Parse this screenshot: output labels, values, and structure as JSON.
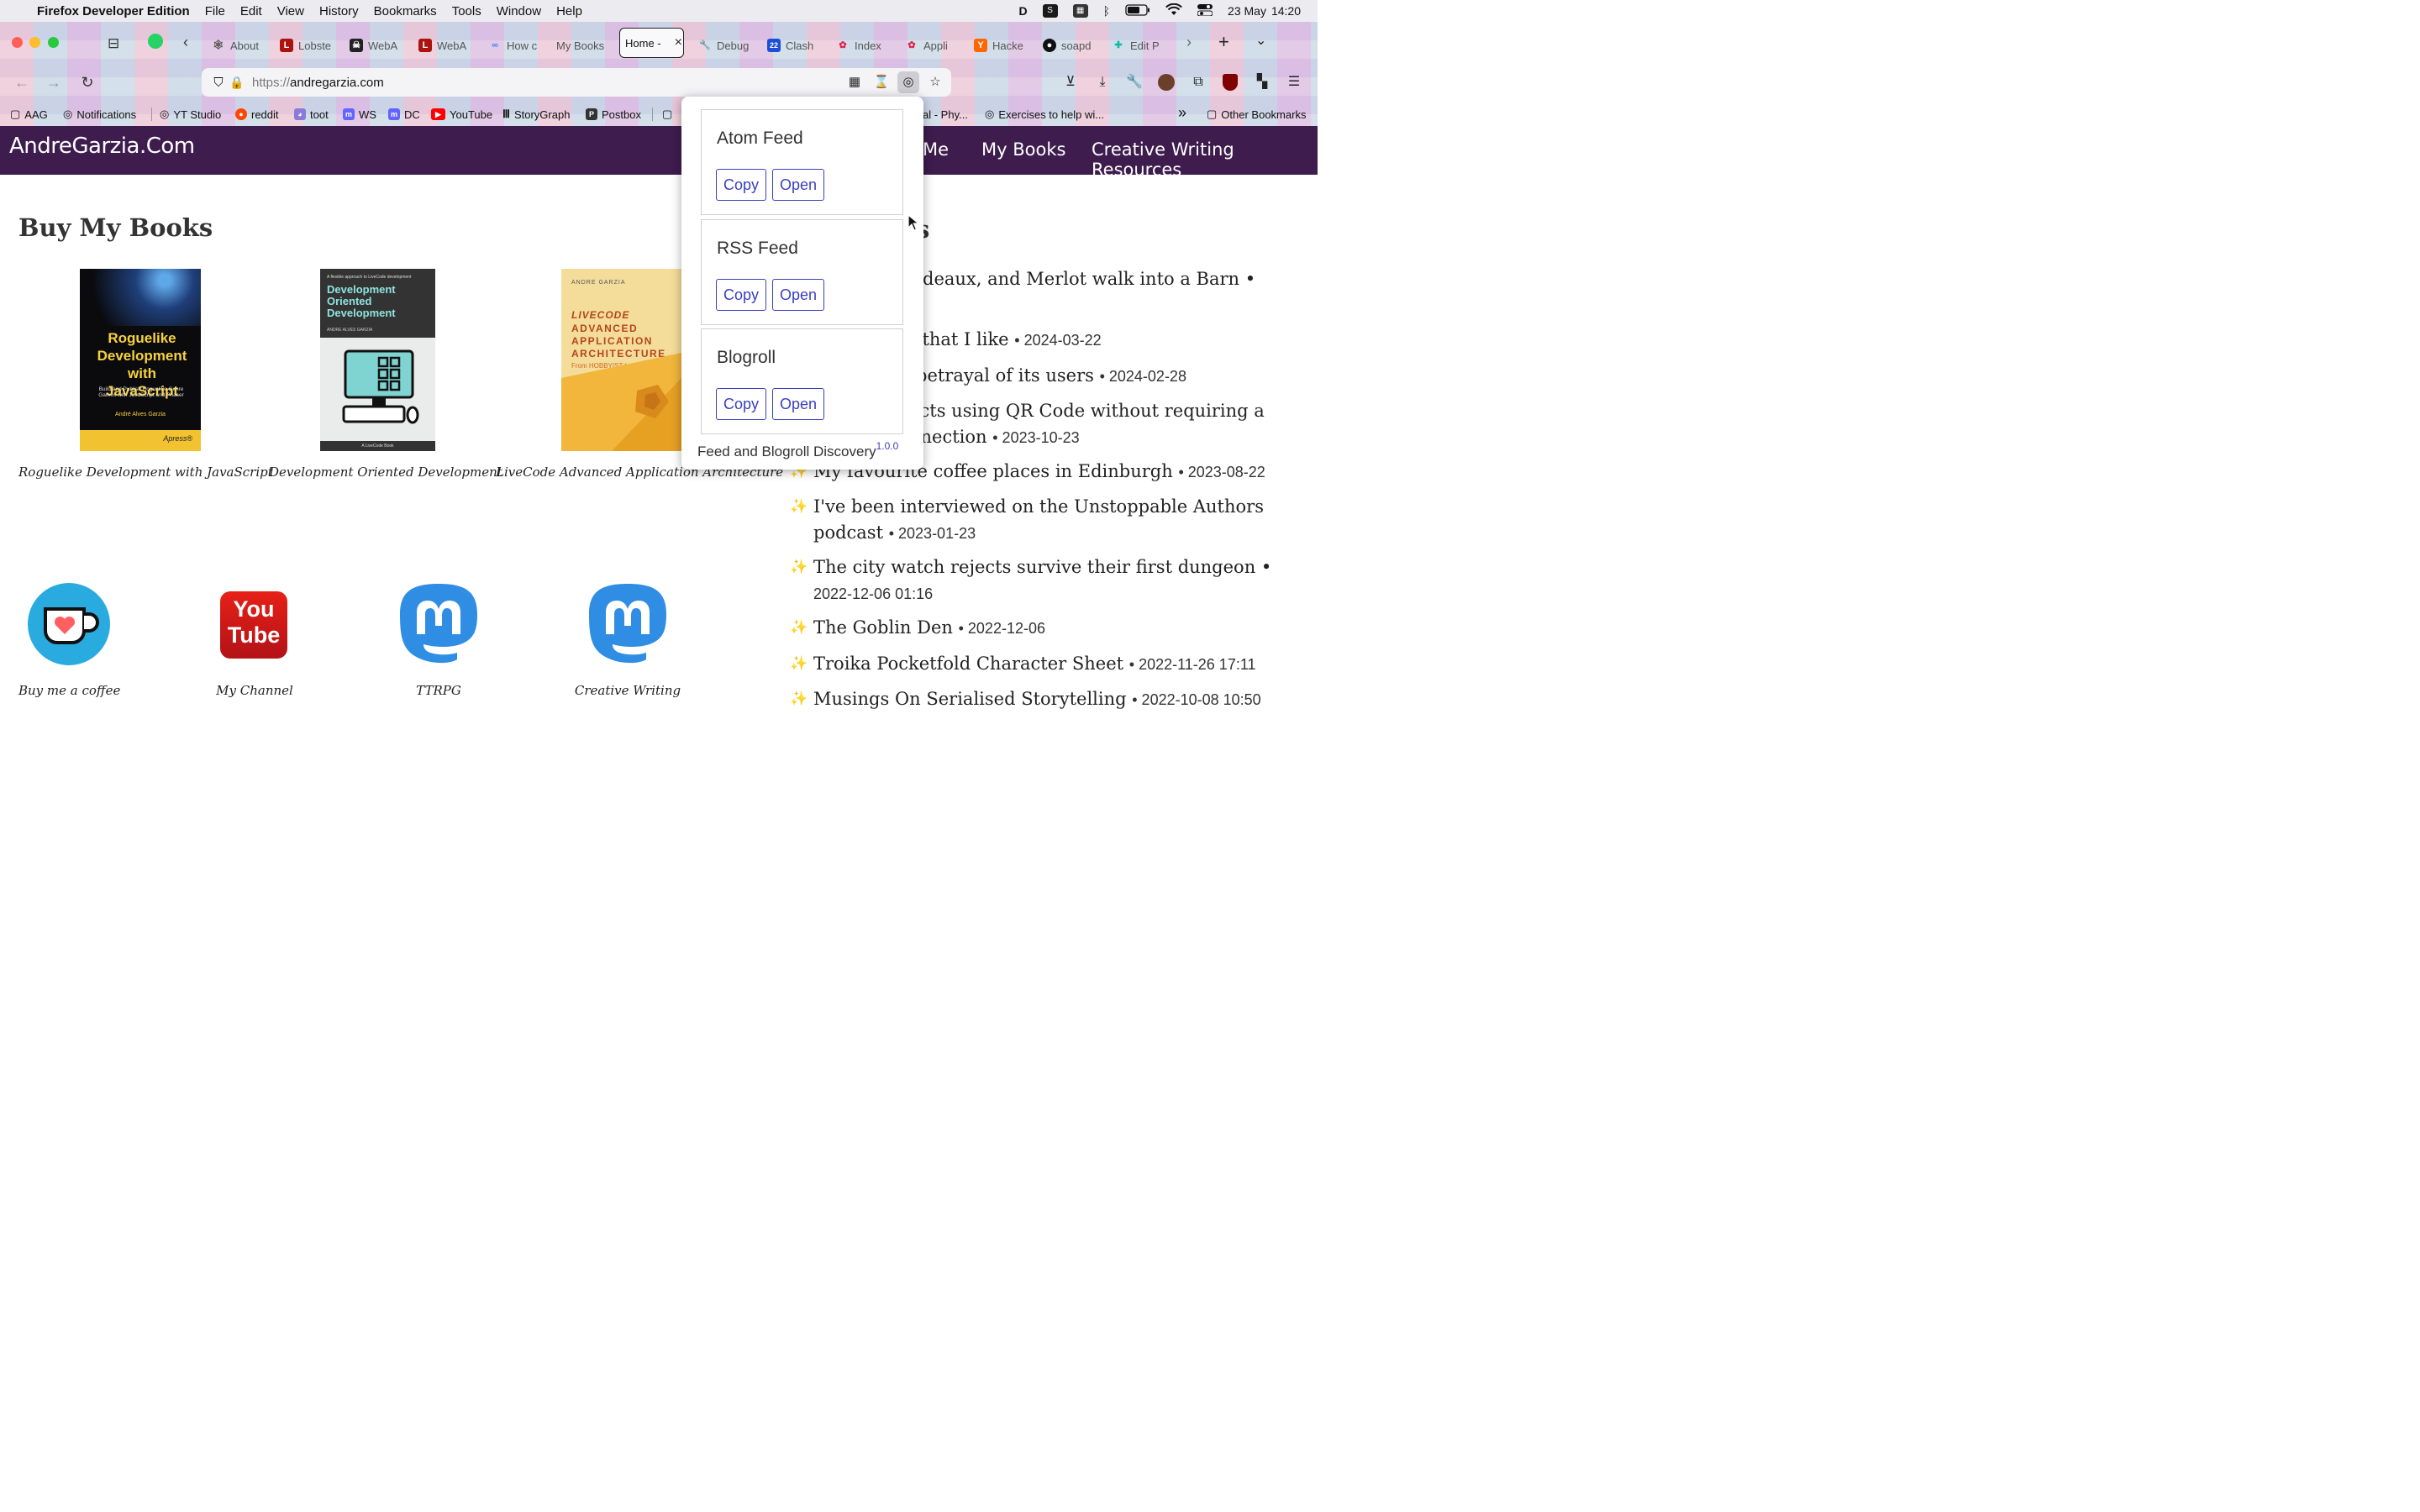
{
  "menubar": {
    "app_name": "Firefox Developer Edition",
    "items": [
      "File",
      "Edit",
      "View",
      "History",
      "Bookmarks",
      "Tools",
      "Window",
      "Help"
    ],
    "date": "23 May",
    "time": "14:20"
  },
  "tabs": [
    {
      "label": "About",
      "fav": "🕸",
      "color": "#888"
    },
    {
      "label": "Lobste",
      "fav": "L",
      "color": "#ac130d"
    },
    {
      "label": "WebA",
      "fav": "🏴",
      "color": "#222"
    },
    {
      "label": "WebA",
      "fav": "L",
      "color": "#ac130d"
    },
    {
      "label": "How c",
      "fav": "∞",
      "color": "#3b82f6"
    },
    {
      "label": "My Books",
      "fav": "",
      "color": ""
    },
    {
      "label": "Home -",
      "fav": "",
      "color": "",
      "active": true
    },
    {
      "label": "Debug",
      "fav": "🔧",
      "color": "#444"
    },
    {
      "label": "Clash",
      "fav": "22",
      "color": "#1d4ed8"
    },
    {
      "label": "Index",
      "fav": "✿",
      "color": "#e11d48"
    },
    {
      "label": "Appli",
      "fav": "✿",
      "color": "#e11d48"
    },
    {
      "label": "Hacke",
      "fav": "Y",
      "color": "#ff6600"
    },
    {
      "label": "soapd",
      "fav": "●",
      "color": "#111"
    },
    {
      "label": "Edit P",
      "fav": "✚",
      "color": "#14b8a6"
    }
  ],
  "url": {
    "protocol": "https://",
    "host": "andregarzia.com"
  },
  "bookmarks": [
    {
      "label": "AAG",
      "fav": "▢",
      "color": "#333"
    },
    {
      "label": "Notifications",
      "fav": "◎",
      "color": "#333"
    },
    {
      "label": "YT Studio",
      "fav": "◎",
      "color": "#333"
    },
    {
      "label": "reddit",
      "fav": "●",
      "color": "#ff4500"
    },
    {
      "label": "toot",
      "fav": "◕",
      "color": "#8b7bd8"
    },
    {
      "label": "WS",
      "fav": "m",
      "color": "#6364ff"
    },
    {
      "label": "DC",
      "fav": "m",
      "color": "#6364ff"
    },
    {
      "label": "YouTube",
      "fav": "▶",
      "color": "#ff0000"
    },
    {
      "label": "StoryGraph",
      "fav": "Ⅲ",
      "color": "#111"
    },
    {
      "label": "Postbox",
      "fav": "P",
      "color": "#333"
    },
    {
      "label": "",
      "fav": "▢",
      "color": "#333"
    },
    {
      "label": "al - Phy...",
      "fav": "",
      "color": ""
    },
    {
      "label": "Exercises to help wi...",
      "fav": "◎",
      "color": "#333"
    }
  ],
  "bookmarks_more": "»",
  "other_bookmarks": "Other Bookmarks",
  "site": {
    "title": "AndreGarzia.Com",
    "nav": [
      "Me",
      "My Books",
      "Creative Writing Resources"
    ]
  },
  "books_heading": "Buy My Books",
  "books": [
    {
      "caption": "Roguelike Development with JavaScript",
      "cover_title": "Roguelike Development with JavaScript",
      "cover_subtitle": "Build and Publish Roguelike Genre Games with JavaScript and Phaser",
      "cover_author": "André Alves Garzia",
      "publisher": "Apress®"
    },
    {
      "caption": "Development Oriented Development",
      "cover_tagline": "A flexible approach to LiveCode development",
      "cover_title": "Development Oriented Development",
      "cover_author": "ANDRE ALVES GARZIA",
      "cover_footer": "A LiveCode Book"
    },
    {
      "caption": "LiveCode Advanced Application Architecture",
      "cover_author": "ANDRE GARZIA",
      "cover_title_1": "LIVECODE",
      "cover_title_2": "ADVANCED APPLICATION ARCHITECTURE",
      "cover_subtitle": "From HOBBYIST to PRO"
    }
  ],
  "social": [
    {
      "caption": "Buy me a coffee",
      "icon": "ko-fi-cup-icon"
    },
    {
      "caption": "My Channel",
      "icon": "youtube-icon",
      "line1": "You",
      "line2": "Tube"
    },
    {
      "caption": "TTRPG",
      "icon": "mastodon-icon"
    },
    {
      "caption": "Creative Writing",
      "icon": "mastodon-icon"
    }
  ],
  "posts_heading_fragment": "s",
  "posts": [
    {
      "title": "deaux, and Merlot walk into a Barn •",
      "date": ""
    },
    {
      "title": "s that I like",
      "date": "• 2024-03-22"
    },
    {
      "title": "betrayal of its users",
      "date": "• 2024-02-28"
    },
    {
      "title": "acts using QR Code without requiring a",
      "title2": "nnection",
      "date": "• 2023-10-23"
    },
    {
      "title": "My favourite coffee places in Edinburgh",
      "date": "• 2023-08-22"
    },
    {
      "title": "I've been interviewed on the Unstoppable Authors",
      "title2": "podcast",
      "date": "• 2023-01-23"
    },
    {
      "title": "The city watch rejects survive their first dungeon •",
      "title2": "",
      "date": "2022-12-06 01:16"
    },
    {
      "title": "The Goblin Den",
      "date": "• 2022-12-06"
    },
    {
      "title": "Troika Pocketfold Character Sheet",
      "date": "• 2022-11-26 17:11"
    },
    {
      "title": "Musings On Serialised Storytelling",
      "date": "• 2022-10-08 10:50"
    }
  ],
  "popup": {
    "feeds": [
      {
        "title": "Atom Feed",
        "copy": "Copy",
        "open": "Open"
      },
      {
        "title": "RSS Feed",
        "copy": "Copy",
        "open": "Open"
      },
      {
        "title": "Blogroll",
        "copy": "Copy",
        "open": "Open"
      }
    ],
    "footer": "Feed and Blogroll Discovery",
    "version": "1.0.0"
  },
  "colors": {
    "header_bg": "#3e1c4e",
    "button_accent": "#3a3fbf",
    "sparkle": "#f4b400"
  }
}
